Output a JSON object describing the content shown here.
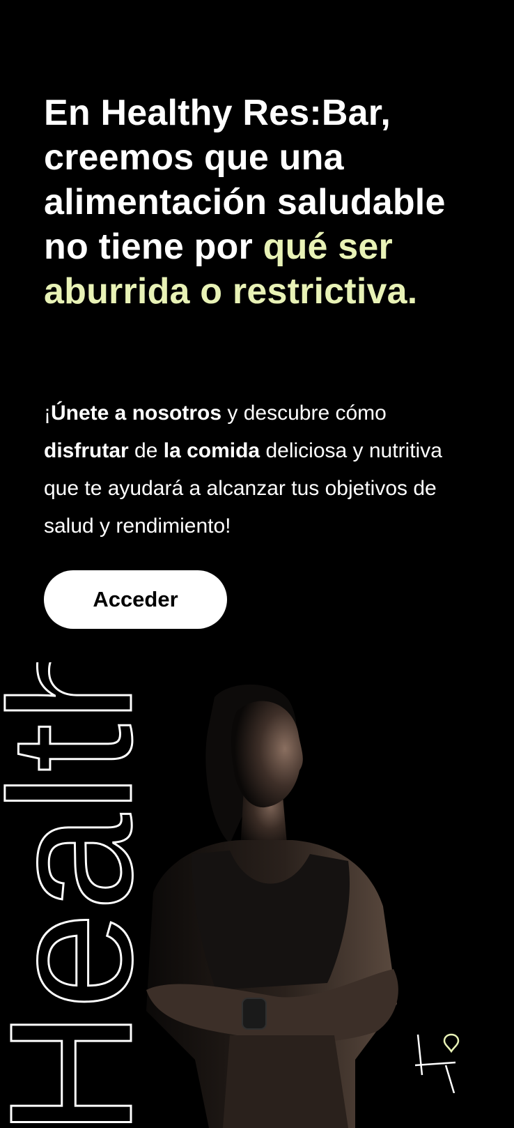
{
  "hero": {
    "headline_main": "En Healthy Res:Bar, creemos que una alimentación saludable no tiene por ",
    "headline_highlight": "qué ser aburrida o restrictiva.",
    "highlight_color": "#e8f2b6"
  },
  "intro": {
    "part1": "¡",
    "bold1": "Únete a nosotros",
    "part2": " y descubre cómo ",
    "bold2": "disfrutar",
    "part3": " de ",
    "bold3": "la comida",
    "part4": " deliciosa y nutritiva que te ayudará a alcanzar tus objetivos de salud y rendimiento!"
  },
  "cta": {
    "label": "Acceder"
  },
  "decor": {
    "vertical_word": "Healthy",
    "logo_accent_color": "#e8f2b6"
  }
}
